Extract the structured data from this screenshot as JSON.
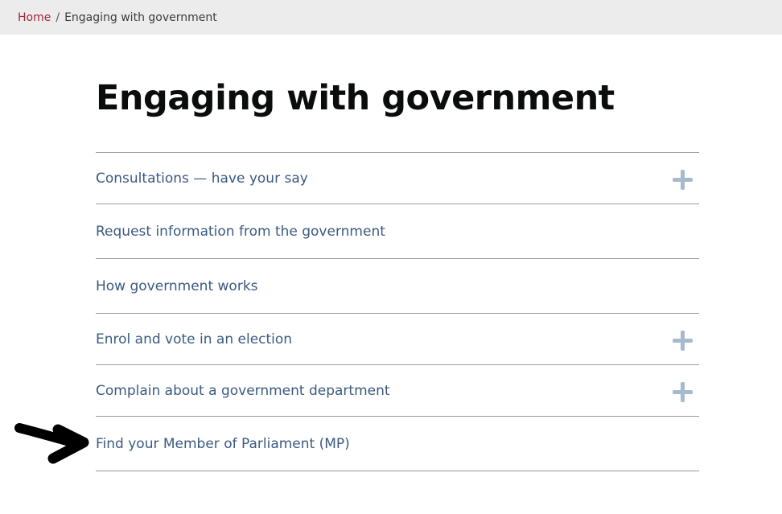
{
  "breadcrumb": {
    "home": "Home",
    "separator": "/",
    "current": "Engaging with government"
  },
  "page": {
    "title": "Engaging with government"
  },
  "items": [
    {
      "label": "Consultations — have your say",
      "expandable": true
    },
    {
      "label": "Request information from the government",
      "expandable": false
    },
    {
      "label": "How government works",
      "expandable": false
    },
    {
      "label": "Enrol and vote in an election",
      "expandable": true
    },
    {
      "label": "Complain about a government department",
      "expandable": true
    },
    {
      "label": "Find your Member of Parliament (MP)",
      "expandable": false
    }
  ],
  "annotation": {
    "icon": "arrow-pointer-icon"
  },
  "colors": {
    "link": "#3a5a80",
    "home_link": "#a0283a",
    "plus": "#a7b9cc",
    "breadcrumb_bg": "#ececec"
  }
}
